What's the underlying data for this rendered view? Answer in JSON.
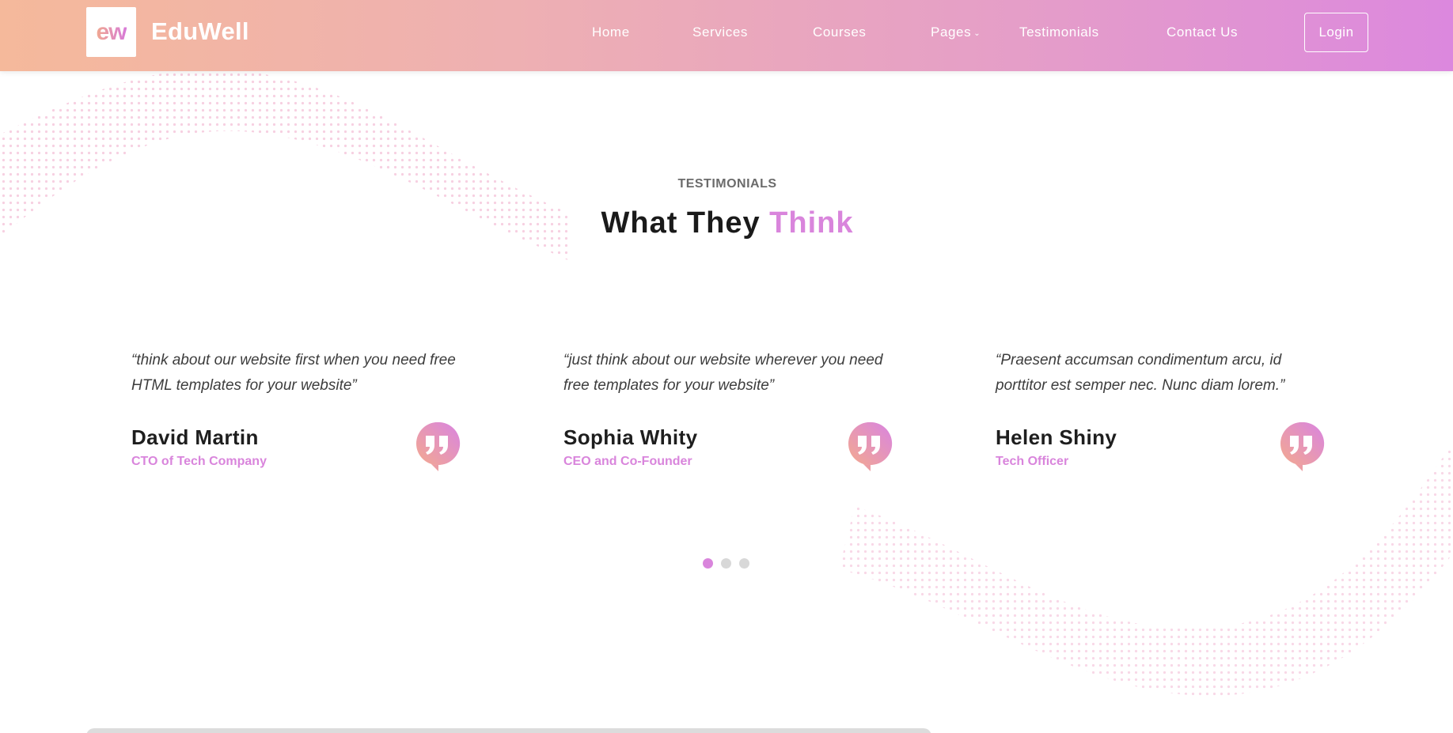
{
  "header": {
    "logo_mark": "ew",
    "brand": "EduWell",
    "nav": [
      {
        "label": "Home"
      },
      {
        "label": "Services"
      },
      {
        "label": "Courses"
      },
      {
        "label": "Pages"
      },
      {
        "label": "Testimonials"
      },
      {
        "label": "Contact Us"
      }
    ],
    "login_label": "Login"
  },
  "section": {
    "eyebrow": "TESTIMONIALS",
    "title_main": "What They",
    "title_accent": "Think"
  },
  "testimonials": [
    {
      "quote": "“think about our website first when you need free HTML templates for your website”",
      "name": "David Martin",
      "role": "CTO of Tech Company"
    },
    {
      "quote": "“just think about our website wherever you need free templates for your website”",
      "name": "Sophia Whity",
      "role": "CEO and Co-Founder"
    },
    {
      "quote": "“Praesent accumsan condimentum arcu, id porttitor est semper nec. Nunc diam lorem.”",
      "name": "Helen Shiny",
      "role": "Tech Officer"
    }
  ],
  "carousel": {
    "total_dots": 3,
    "active_dot": 1
  },
  "colors": {
    "accent": "#d985dc",
    "header_gradient_start": "#f5b99b",
    "header_gradient_end": "#dc88de"
  },
  "icons": {
    "quote_badge": "quote-bubble-icon",
    "pages_caret": "chevron-down-icon"
  }
}
